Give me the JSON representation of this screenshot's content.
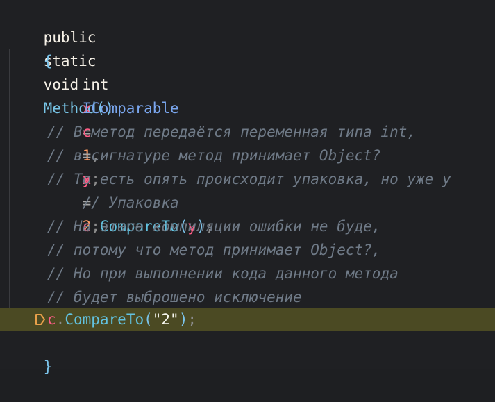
{
  "code": {
    "signature": {
      "kw_public": "public",
      "kw_static": "static",
      "kw_void": "void",
      "method_name": "Method",
      "parens": "()"
    },
    "open_brace": "{",
    "close_brace": "}",
    "line_int": {
      "type": "int",
      "var_x": "x",
      "eq1": "=",
      "val1": "1",
      "comma": ",",
      "var_y": "y",
      "eq2": "=",
      "val2": "2",
      "semi": ";"
    },
    "line_icomparable": {
      "type": "IComparable",
      "var_c": "c",
      "eq": "=",
      "var_x": "x",
      "semi": ";",
      "comment": "// Упаковка"
    },
    "comments_block1": [
      "// В метод передаётся переменная типа int,",
      "// в сигнатуре метод принимает Object?",
      "// То есть опять происходит упаковка, но уже у"
    ],
    "line_compare_y": {
      "obj": "c",
      "dot": ".",
      "method": "CompareTo",
      "open": "(",
      "arg": "y",
      "close": ")",
      "semi": ";"
    },
    "comments_block2": [
      "// На этапе компиляции ошибки не буде,",
      "// потому что метод принимает Object?,",
      "// Но при выполнении кода данного метода",
      "// будет выброшено исключение"
    ],
    "line_compare_str": {
      "obj": "c",
      "dot": ".",
      "method": "CompareTo",
      "open": "(",
      "arg": "\"2\"",
      "close": ")",
      "semi": ";"
    },
    "highlight_color": "#4b4a23",
    "marker_icon": "breakpoint-arrow-icon"
  }
}
